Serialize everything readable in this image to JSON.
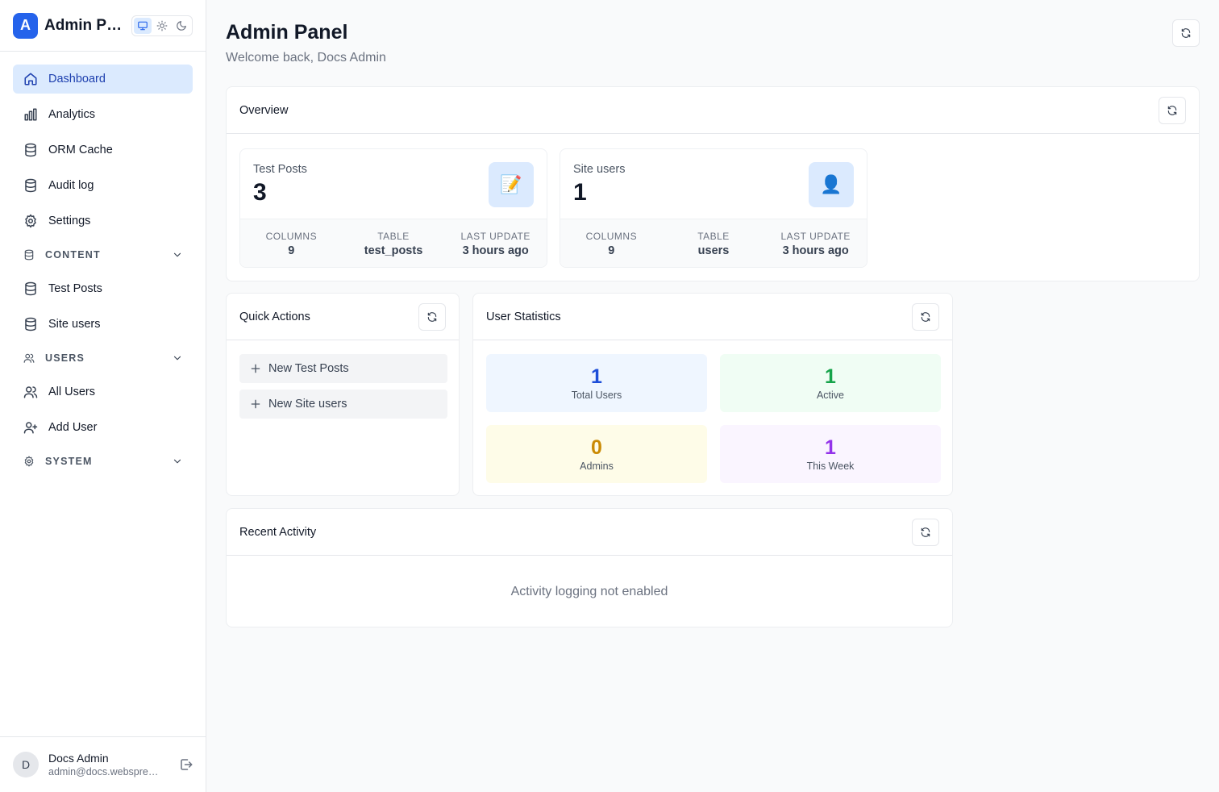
{
  "app": {
    "logo_letter": "A",
    "title": "Admin Panel"
  },
  "colors": {
    "accent": "#2563eb",
    "total_users": "#1d4ed8",
    "active": "#16a34a",
    "admins": "#ca8a04",
    "this_week": "#9333ea"
  },
  "sidebar": {
    "theme_modes": [
      "monitor-icon",
      "sun-icon",
      "moon-icon"
    ],
    "items": [
      {
        "label": "Dashboard",
        "icon": "home-icon",
        "active": true
      },
      {
        "label": "Analytics",
        "icon": "bar-chart-icon"
      },
      {
        "label": "ORM Cache",
        "icon": "database-icon"
      },
      {
        "label": "Audit log",
        "icon": "database-icon"
      },
      {
        "label": "Settings",
        "icon": "gear-icon"
      }
    ],
    "sections": {
      "content": {
        "label": "CONTENT",
        "items": [
          {
            "label": "Test Posts"
          },
          {
            "label": "Site users"
          }
        ]
      },
      "users": {
        "label": "USERS",
        "items": [
          {
            "label": "All Users"
          },
          {
            "label": "Add User"
          }
        ]
      },
      "system": {
        "label": "SYSTEM"
      }
    },
    "user": {
      "initial": "D",
      "name": "Docs Admin",
      "email": "admin@docs.webspresso.dev"
    }
  },
  "header": {
    "title": "Admin Panel",
    "subtitle": "Welcome back, Docs Admin"
  },
  "overview": {
    "title": "Overview",
    "cards": [
      {
        "label": "Test Posts",
        "value": "3",
        "icon": "memo-icon",
        "emoji": "📝",
        "columns_label": "COLUMNS",
        "columns": "9",
        "table_label": "TABLE",
        "table": "test_posts",
        "updated_label": "LAST UPDATE",
        "updated": "3 hours ago"
      },
      {
        "label": "Site users",
        "value": "1",
        "icon": "user-icon",
        "emoji": "👤",
        "columns_label": "COLUMNS",
        "columns": "9",
        "table_label": "TABLE",
        "table": "users",
        "updated_label": "LAST UPDATE",
        "updated": "3 hours ago"
      }
    ]
  },
  "quick_actions": {
    "title": "Quick Actions",
    "items": [
      {
        "label": "New Test Posts"
      },
      {
        "label": "New Site users"
      }
    ]
  },
  "user_stats": {
    "title": "User Statistics",
    "boxes": [
      {
        "value": "1",
        "label": "Total Users"
      },
      {
        "value": "1",
        "label": "Active"
      },
      {
        "value": "0",
        "label": "Admins"
      },
      {
        "value": "1",
        "label": "This Week"
      }
    ]
  },
  "recent_activity": {
    "title": "Recent Activity",
    "empty": "Activity logging not enabled"
  }
}
